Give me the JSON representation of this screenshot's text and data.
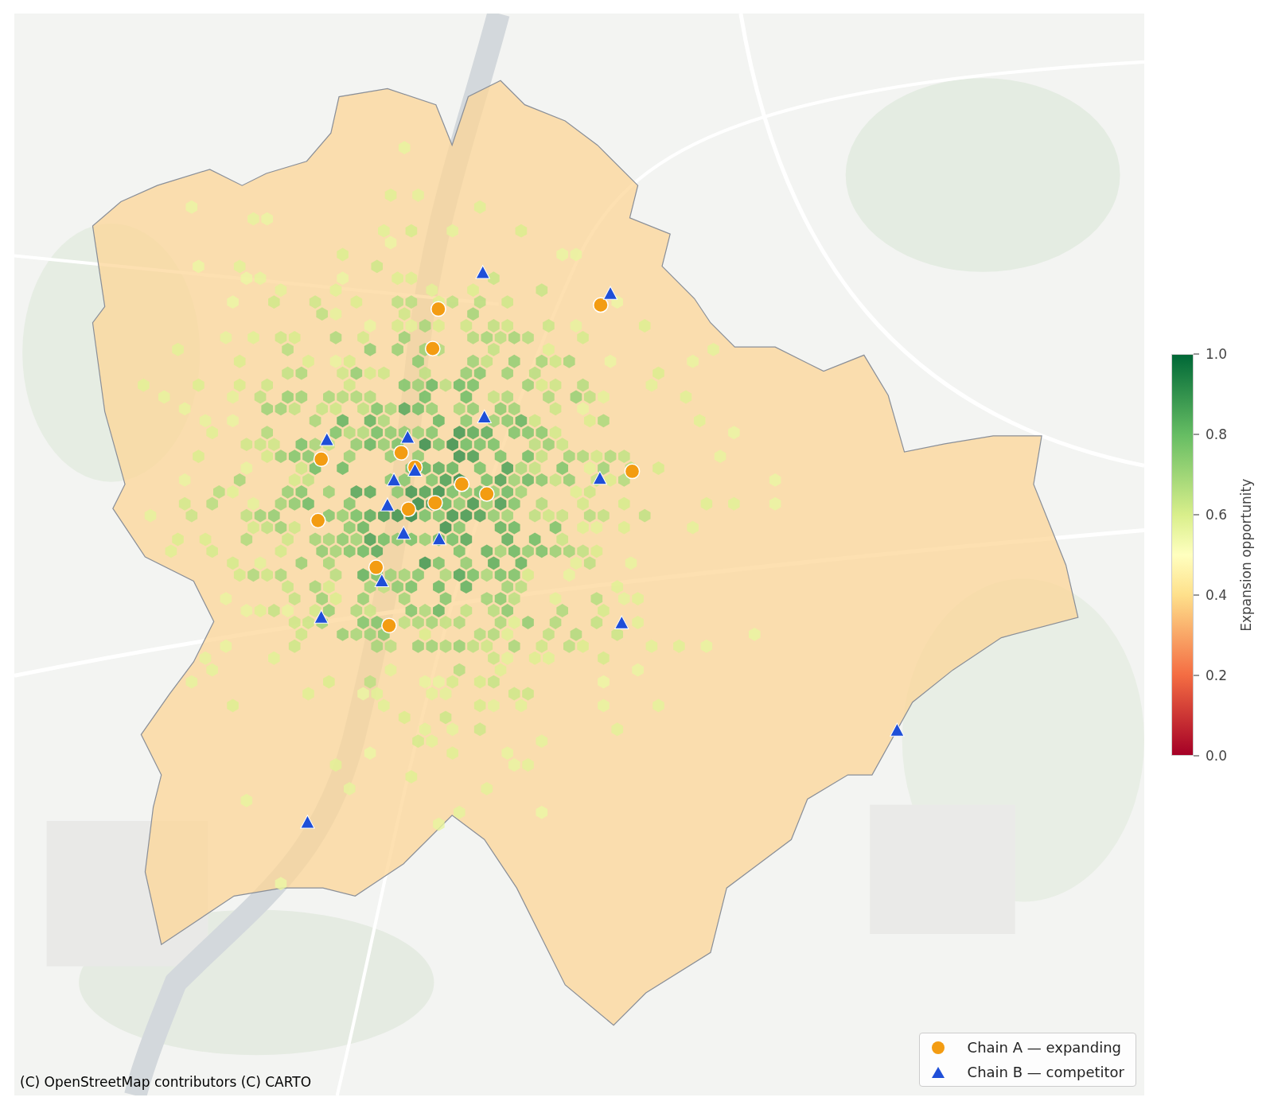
{
  "map": {
    "kind": "picture",
    "attribution": "(C) OpenStreetMap contributors (C) CARTO"
  },
  "legend": [
    {
      "kind": "circle",
      "color": "#f39c12",
      "label": "Chain A — expanding"
    },
    {
      "kind": "triangle",
      "color": "#1f4fd8",
      "label": "Chain B — competitor"
    }
  ],
  "colorbar": {
    "label": "Expansion opportunity",
    "ticks": [
      "1.0",
      "0.8",
      "0.6",
      "0.4",
      "0.2",
      "0.0"
    ]
  }
}
